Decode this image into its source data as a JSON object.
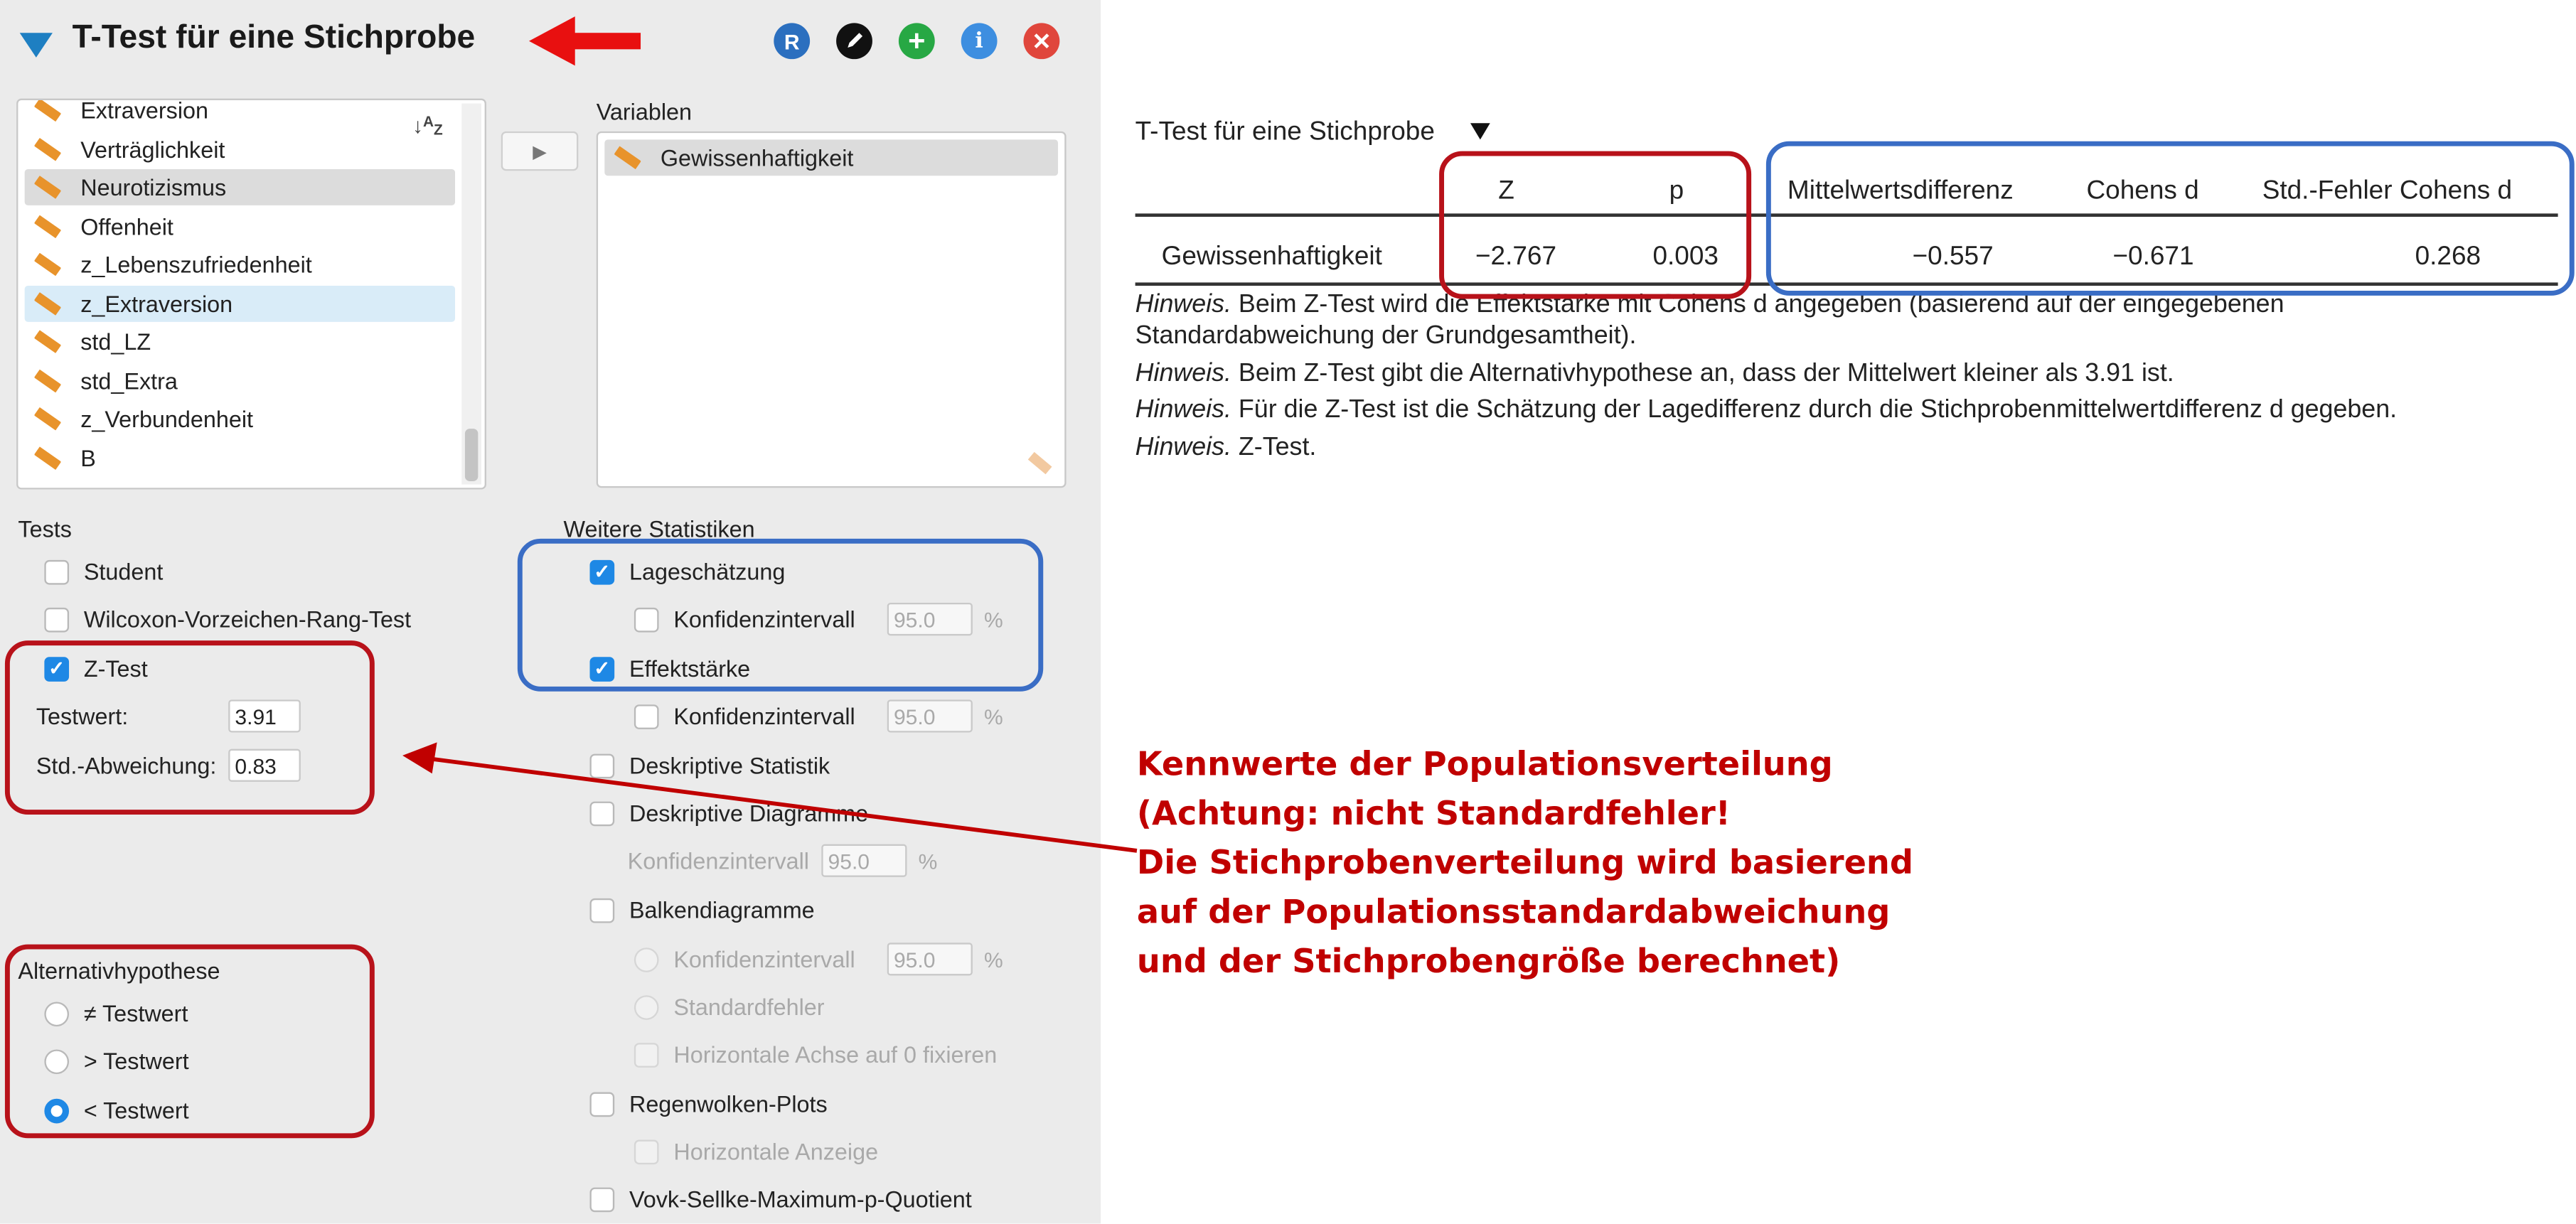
{
  "header": {
    "title": "T-Test für eine Stichprobe"
  },
  "variable_list": [
    "Extraversion",
    "Verträglichkeit",
    "Neurotizismus",
    "Offenheit",
    "z_Lebenszufriedenheit",
    "z_Extraversion",
    "std_LZ",
    "std_Extra",
    "z_Verbundenheit",
    "B"
  ],
  "variables_box": {
    "label": "Variablen",
    "items": [
      "Gewissenhaftigkeit"
    ]
  },
  "tests": {
    "label": "Tests",
    "student": "Student",
    "wilcoxon": "Wilcoxon-Vorzeichen-Rang-Test",
    "ztest": "Z-Test",
    "testwert_label": "Testwert:",
    "testwert_value": "3.91",
    "sd_label": "Std.-Abweichung:",
    "sd_value": "0.83"
  },
  "alternative": {
    "label": "Alternativhypothese",
    "options": [
      "≠ Testwert",
      "> Testwert",
      "< Testwert"
    ],
    "selected": "< Testwert"
  },
  "further": {
    "label": "Weitere Statistiken",
    "lage": "Lageschätzung",
    "ki": "Konfidenzintervall",
    "ki_value": "95.0",
    "pct": "%",
    "effekt": "Effektstärke",
    "deskriptiv": "Deskriptive Statistik",
    "deskriptiv_diag": "Deskriptive Diagramme",
    "balken": "Balkendiagramme",
    "stdfehler": "Standardfehler",
    "horiz_achse": "Horizontale Achse auf 0 fixieren",
    "regenwolken": "Regenwolken-Plots",
    "horiz_anzeige": "Horizontale Anzeige",
    "vovk": "Vovk-Sellke-Maximum-p-Quotient"
  },
  "results": {
    "title": "T-Test für eine Stichprobe",
    "headers": [
      "Z",
      "p",
      "Mittelwertsdifferenz",
      "Cohens d",
      "Std.-Fehler Cohens d"
    ],
    "row": {
      "label": "Gewissenhaftigkeit",
      "values": [
        "−2.767",
        "0.003",
        "−0.557",
        "−0.671",
        "0.268"
      ]
    },
    "notes": [
      {
        "prefix": "Hinweis.",
        "text": "  Beim Z-Test wird die Effektstärke mit Cohens d angegeben (basierend auf der eingegebenen"
      },
      {
        "prefix": "",
        "text": "Standardabweichung der Grundgesamtheit)."
      },
      {
        "prefix": "Hinweis.",
        "text": " Beim Z-Test gibt die Alternativhypothese an, dass der Mittelwert kleiner als 3.91 ist."
      },
      {
        "prefix": "Hinweis.",
        "text": " Für die Z-Test ist die Schätzung der Lagedifferenz durch die Stichprobenmittelwertdifferenz d gegeben."
      },
      {
        "prefix": "Hinweis.",
        "text": " Z-Test."
      }
    ]
  },
  "annotation": [
    "Kennwerte der Populationsverteilung",
    "(Achtung: nicht Standardfehler!",
    "Die Stichprobenverteilung wird basierend",
    "auf der Populationsstandardabweichung",
    "und der Stichprobengröße berechnet)"
  ],
  "colors": {
    "highlight_red": "#b8121a",
    "highlight_blue": "#3a6dc5",
    "annotation_text": "#c00000",
    "accent": "#1e88e5"
  },
  "icons": [
    "collapse-triangle-icon",
    "red-arrow-icon",
    "r-syntax-icon",
    "edit-icon",
    "add-icon",
    "info-icon",
    "close-icon",
    "sort-icon",
    "ruler-icon",
    "move-arrow-icon"
  ]
}
